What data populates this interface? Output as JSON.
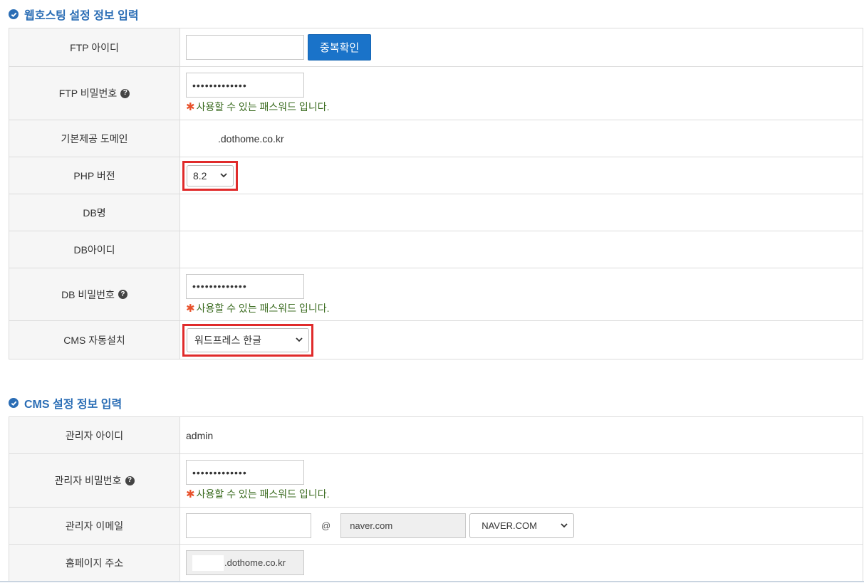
{
  "section1": {
    "title": "웹호스팅 설정 정보 입력",
    "ftp_id_label": "FTP 아이디",
    "ftp_id_value": "",
    "dup_check_label": "중복확인",
    "ftp_pw_label": "FTP 비밀번호",
    "ftp_pw_value": "•••••••••••••",
    "ftp_pw_note": "사용할 수 있는 패스워드 입니다.",
    "domain_label": "기본제공 도메인",
    "domain_value": ".dothome.co.kr",
    "php_label": "PHP 버전",
    "php_value": "8.2",
    "db_name_label": "DB명",
    "db_id_label": "DB아이디",
    "db_pw_label": "DB 비밀번호",
    "db_pw_value": "•••••••••••••",
    "db_pw_note": "사용할 수 있는 패스워드 입니다.",
    "cms_label": "CMS 자동설치",
    "cms_value": "워드프레스 한글"
  },
  "section2": {
    "title": "CMS 설정 정보 입력",
    "admin_id_label": "관리자 아이디",
    "admin_id_value": "admin",
    "admin_pw_label": "관리자 비밀번호",
    "admin_pw_value": "•••••••••••••",
    "admin_pw_note": "사용할 수 있는 패스워드 입니다.",
    "email_label": "관리자 이메일",
    "email_local": "",
    "email_at": "@",
    "email_domain": "naver.com",
    "email_select": "NAVER.COM",
    "homepage_label": "홈페이지 주소",
    "homepage_value": ".dothome.co.kr"
  },
  "icons": {
    "star": "✱",
    "help": "?",
    "chevron": "⌄"
  },
  "colors": {
    "accent": "#2a6db5",
    "button": "#1a73c9",
    "highlight": "#e02b2b",
    "note": "#3a6b1f",
    "star": "#e8522c"
  }
}
